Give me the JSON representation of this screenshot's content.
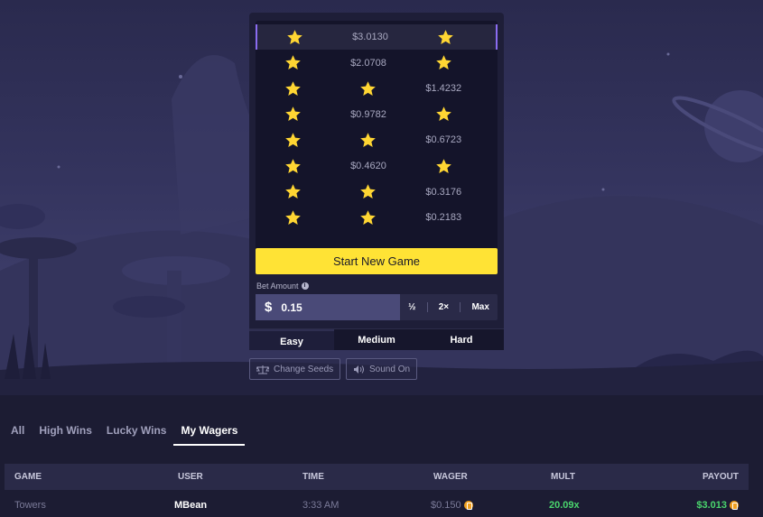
{
  "game": {
    "rows": [
      [
        "star",
        "$3.0130",
        "star"
      ],
      [
        "star",
        "$2.0708",
        "star"
      ],
      [
        "star",
        "star",
        "$1.4232"
      ],
      [
        "star",
        "$0.9782",
        "star"
      ],
      [
        "star",
        "star",
        "$0.6723"
      ],
      [
        "star",
        "$0.4620",
        "star"
      ],
      [
        "star",
        "star",
        "$0.3176"
      ],
      [
        "star",
        "star",
        "$0.2183"
      ]
    ],
    "active_row": 0,
    "start_label": "Start New Game",
    "bet_label": "Bet Amount",
    "currency_symbol": "$",
    "bet_value": "0.15",
    "half_label": "½",
    "double_label": "2×",
    "max_label": "Max",
    "difficulties": [
      "Easy",
      "Medium",
      "Hard"
    ],
    "selected_difficulty": "Easy",
    "change_seeds_label": "Change Seeds",
    "sound_label": "Sound On",
    "accent_color": "#ffe335",
    "star_color": "#ffd633"
  },
  "wagers": {
    "tabs": [
      "All",
      "High Wins",
      "Lucky Wins",
      "My Wagers"
    ],
    "active_tab": "My Wagers",
    "columns": [
      "GAME",
      "USER",
      "TIME",
      "WAGER",
      "MULT",
      "PAYOUT"
    ],
    "rows": [
      {
        "game": "Towers",
        "user": "MBean",
        "time": "3:33 AM",
        "wager": "$0.150",
        "mult": "20.09x",
        "payout": "$3.013"
      }
    ],
    "win_color": "#4ad66d"
  }
}
